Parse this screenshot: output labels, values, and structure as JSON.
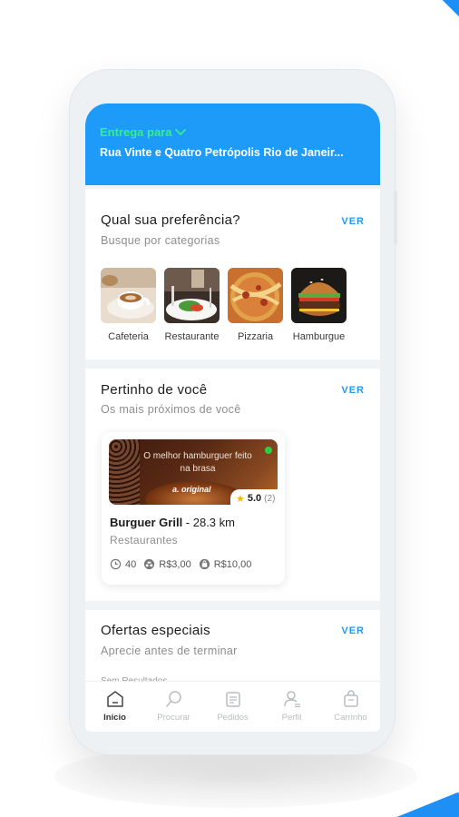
{
  "colors": {
    "primary": "#1e9af8",
    "accent_green": "#33f08a",
    "star": "#f5b800"
  },
  "header": {
    "deliver_label": "Entrega para",
    "address": "Rua Vinte e Quatro Petrópolis Rio de Janeir..."
  },
  "categories_section": {
    "title": "Qual sua preferência?",
    "subtitle": "Busque por categorias",
    "see_all": "VER",
    "items": [
      {
        "label": "Cafeteria",
        "icon": "coffee-photo"
      },
      {
        "label": "Restaurante",
        "icon": "restaurant-photo"
      },
      {
        "label": "Pizzaria",
        "icon": "pizza-photo"
      },
      {
        "label": "Hamburgue",
        "icon": "burger-photo"
      }
    ]
  },
  "nearby_section": {
    "title": "Pertinho de você",
    "subtitle": "Os mais próximos de você",
    "see_all": "VER",
    "restaurant": {
      "banner_text": "O melhor hamburguer feito na brasa",
      "banner_signature": "a. original",
      "rating": "5.0",
      "rating_count": "(2)",
      "name": "Burguer Grill",
      "distance": " - 28.3 km",
      "category": "Restaurantes",
      "delivery_time": "40",
      "delivery_fee": "R$3,00",
      "min_order": "R$10,00"
    }
  },
  "offers_section": {
    "title": "Ofertas especiais",
    "subtitle": "Aprecie antes de terminar",
    "see_all": "VER",
    "empty_text": "Sem Resultados"
  },
  "bottom_nav": [
    {
      "label": "Início",
      "icon": "home-icon",
      "active": true
    },
    {
      "label": "Procurar",
      "icon": "search-icon",
      "active": false
    },
    {
      "label": "Pedidos",
      "icon": "orders-icon",
      "active": false
    },
    {
      "label": "Perfil",
      "icon": "profile-icon",
      "active": false
    },
    {
      "label": "Carrinho",
      "icon": "cart-icon",
      "active": false
    }
  ]
}
